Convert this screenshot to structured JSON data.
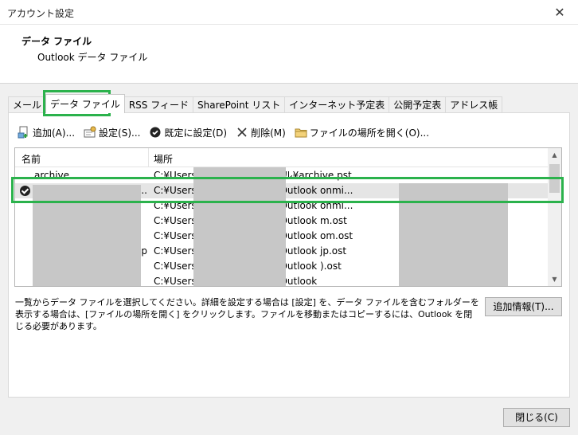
{
  "window": {
    "title": "アカウント設定",
    "close_glyph": "✕"
  },
  "header": {
    "title": "データ ファイル",
    "subtitle": "Outlook データ ファイル"
  },
  "tabs": [
    {
      "label": "メール"
    },
    {
      "label": "データ ファイル",
      "active": true
    },
    {
      "label": "RSS フィード"
    },
    {
      "label": "SharePoint リスト"
    },
    {
      "label": "インターネット予定表"
    },
    {
      "label": "公開予定表"
    },
    {
      "label": "アドレス帳"
    }
  ],
  "toolbar": {
    "add": "追加(A)...",
    "settings": "設定(S)...",
    "set_default": "既定に設定(D)",
    "delete": "削除(M)",
    "open_location": "ファイルの場所を開く(O)..."
  },
  "grid": {
    "col_name": "名前",
    "col_location": "場所",
    "rows": [
      {
        "name": "archive",
        "path": "C:¥Users ts¥Outlook ファイル¥archive.pst"
      },
      {
        "name": "...",
        "path": "C:¥Users Local¥Microsoft¥Outlook onmi...",
        "selected": true,
        "default": true
      },
      {
        "name": "",
        "path": "C:¥Users Local¥Microsoft¥Outlook onmi..."
      },
      {
        "name": "",
        "path": "C:¥Users Local¥Microsoft¥Outlook m.ost"
      },
      {
        "name": "",
        "path": "C:¥Users Local¥Microsoft¥Outlook om.ost"
      },
      {
        "name": "p",
        "path": "C:¥Users Local¥Microsoft¥Outlook jp.ost"
      },
      {
        "name": "",
        "path": "C:¥Users Local¥Microsoft¥Outlook ).ost"
      },
      {
        "name": "",
        "path": "C:¥Users Local¥Microsoft¥Outlook"
      }
    ]
  },
  "description": "一覧からデータ ファイルを選択してください。詳細を設定する場合は [設定] を、データ ファイルを含むフォルダーを表示する場合は、[ファイルの場所を開く] をクリックします。ファイルを移動またはコピーするには、Outlook を閉じる必要があります。",
  "buttons": {
    "more_info": "追加情報(T)...",
    "close": "閉じる(C)"
  },
  "colors": {
    "highlight": "#2bb24c",
    "redaction": "#c7c7c7"
  }
}
